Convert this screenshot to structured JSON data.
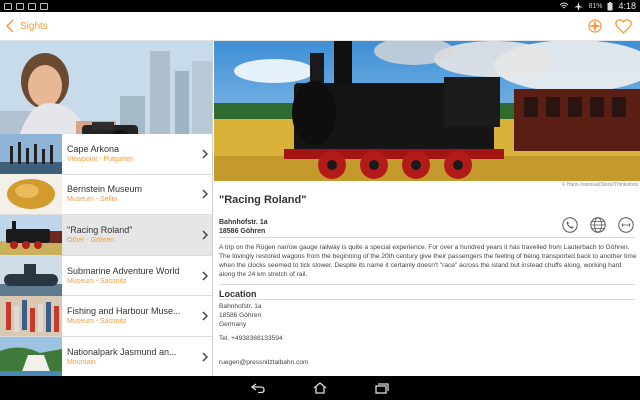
{
  "status": {
    "battery": "81%",
    "time": "4:18"
  },
  "actionbar": {
    "title": "Sights",
    "accent": "#f39c3d"
  },
  "list": {
    "items": [
      {
        "title": "Cape Arkona",
        "subtitle": "Viewpoint - Putgarten"
      },
      {
        "title": "Bernstein Museum",
        "subtitle": "Museum - Sellin"
      },
      {
        "title": "\"Racing Roland\"",
        "subtitle": "Other - Göhren",
        "selected": true
      },
      {
        "title": "Submarine Adventure World",
        "subtitle": "Museum - Sassnitz"
      },
      {
        "title": "Fishing and Harbour Muse...",
        "subtitle": "Museum - Sassnitz"
      },
      {
        "title": "Nationalpark Jasmund an...",
        "subtitle": "Mountain"
      }
    ]
  },
  "detail": {
    "credit": "© Hans-Ivanova/iStock/Thinkstock",
    "title": "\"Racing Roland\"",
    "address_line1": "Bahnhofstr. 1a",
    "address_line2": "18586 Göhren",
    "description": "A trip on the Rügen narrow gauge railway is quite a special experience. For over a hundred years it has travelled from Lauterbach to Göhren. The lovingly restored wagons from the beginning of the 20th century give their passengers the feeling of being transported back to another time when the clocks seemed to tick slower. Despite its name it certainly doesn't \"race\" across the island but instead chuffs along, working hard along the 24 km stretch of rail.",
    "location_heading": "Location",
    "loc_line1": "Bahnhofstr. 1a",
    "loc_line2": "18586 Göhren",
    "loc_line3": "Germany",
    "tel": "Tel. +4938388133594",
    "email": "ruegen@pressnitztalbahn.com"
  },
  "icons": {
    "back": "chevron-left-icon",
    "compass": "compass-icon",
    "favorite": "heart-icon",
    "phone": "phone-icon",
    "web": "globe-icon",
    "route": "route-icon"
  }
}
